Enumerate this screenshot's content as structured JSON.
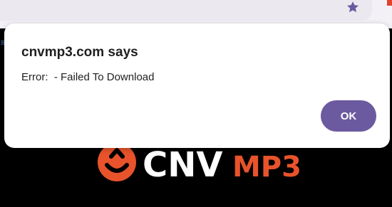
{
  "dialog": {
    "title": "cnvmp3.com says",
    "message": "Error:  - Failed To Download",
    "ok_label": "OK"
  },
  "site": {
    "logo_text_white": "CNV",
    "logo_text_orange": "MP3"
  },
  "browser": {
    "bookmark_icon": "star-icon"
  },
  "colors": {
    "accent_button": "#6b5a9f",
    "logo_orange": "#e8532b",
    "star": "#6b5a9f"
  }
}
